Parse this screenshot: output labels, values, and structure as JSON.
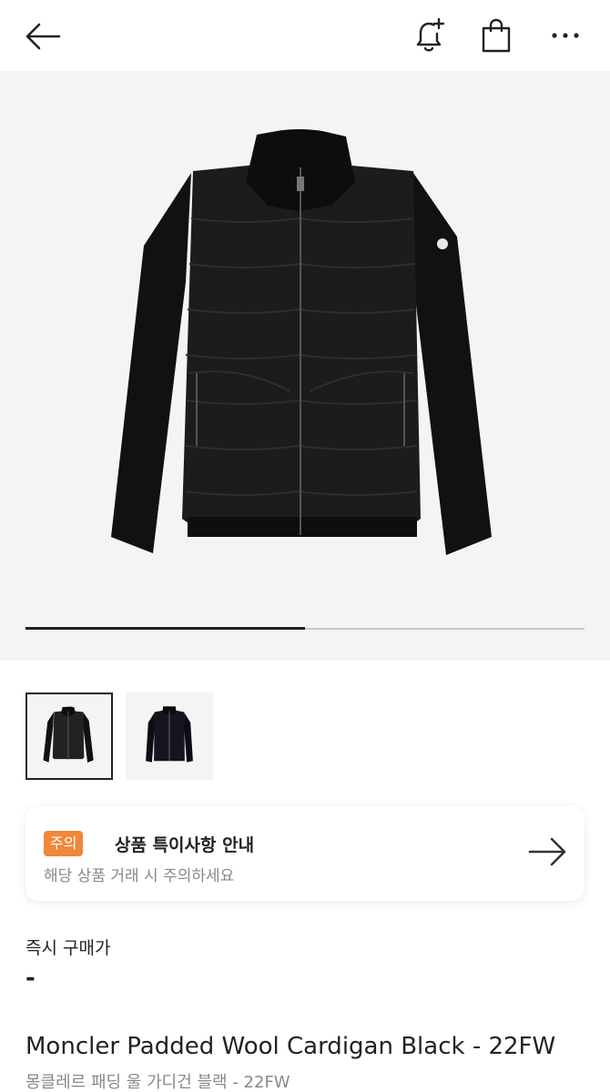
{
  "header": {
    "icons": [
      "back-arrow-icon",
      "bell-plus-icon",
      "shopping-bag-icon",
      "more-dots-icon"
    ]
  },
  "gallery": {
    "image_count": 2,
    "current_index": 1,
    "progress_fraction": 0.5
  },
  "notice": {
    "badge": "주의",
    "title": "상품 특이사항 안내",
    "subtitle": "해당 상품 거래 시 주의하세요",
    "badge_color": "#f0873a"
  },
  "price": {
    "label": "즉시 구매가",
    "value": "-"
  },
  "product": {
    "name": "Moncler Padded Wool Cardigan Black - 22FW",
    "name_ko": "몽클레르 패딩 울 가디건 블랙 - 22FW"
  }
}
